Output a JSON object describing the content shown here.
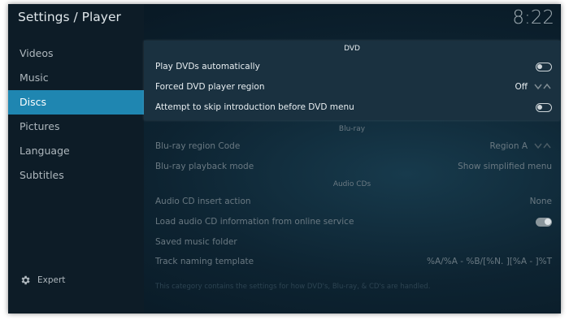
{
  "app": {
    "title": "Settings / Player",
    "clock": "8:22"
  },
  "sidebar": {
    "items": [
      {
        "label": "Videos"
      },
      {
        "label": "Music"
      },
      {
        "label": "Discs"
      },
      {
        "label": "Pictures"
      },
      {
        "label": "Language"
      },
      {
        "label": "Subtitles"
      }
    ],
    "active": "Discs",
    "expert_label": "Expert"
  },
  "sections": {
    "dvd": {
      "title": "DVD",
      "play_auto": {
        "label": "Play DVDs automatically",
        "state": "off"
      },
      "region": {
        "label": "Forced DVD player region",
        "value": "Off"
      },
      "skip_intro": {
        "label": "Attempt to skip introduction before DVD menu",
        "state": "off"
      }
    },
    "bluray": {
      "title": "Blu-ray",
      "region_code": {
        "label": "Blu-ray region Code",
        "value": "Region A"
      },
      "playback_mode": {
        "label": "Blu-ray playback mode",
        "value": "Show simplified menu"
      }
    },
    "audiocd": {
      "title": "Audio CDs",
      "insert_action": {
        "label": "Audio CD insert action",
        "value": "None"
      },
      "online_info": {
        "label": "Load audio CD information from online service",
        "state": "on"
      },
      "saved_folder": {
        "label": "Saved music folder"
      },
      "naming_template": {
        "label": "Track naming template",
        "value": "%A/%A - %B/[%N. ][%A - ]%T"
      }
    }
  },
  "footer": {
    "description": "This category contains the settings for how DVD's, Blu-ray, & CD's are handled."
  },
  "colors": {
    "accent": "#1f86b1",
    "background": "#0d2331",
    "sidebar": "#0d1c27"
  }
}
